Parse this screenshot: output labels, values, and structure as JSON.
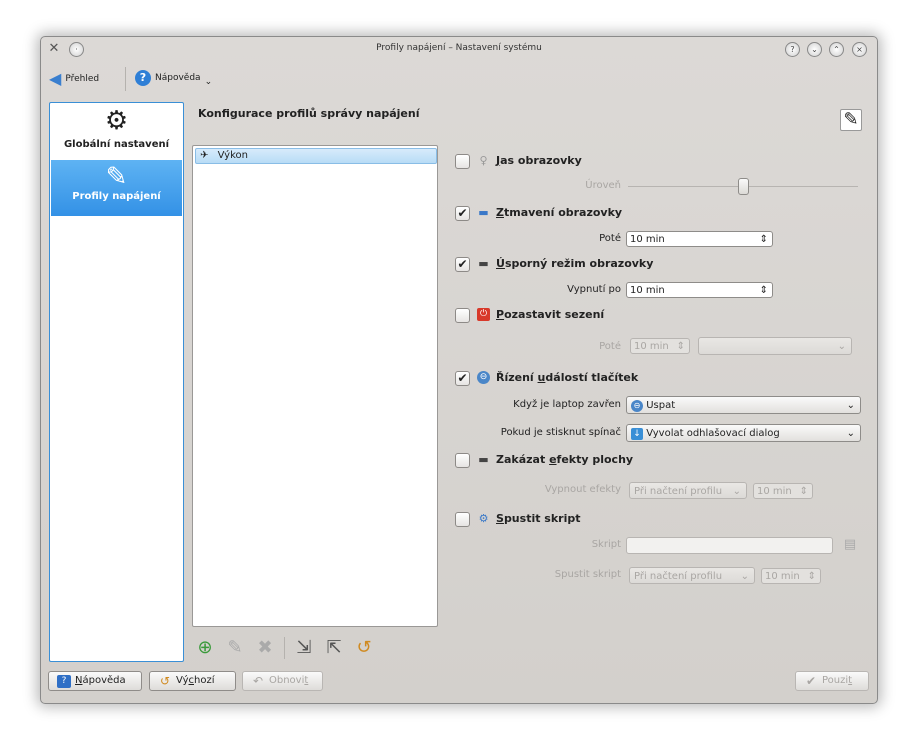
{
  "window": {
    "title": "Profily napájení – Nastavení systému"
  },
  "toolbar": {
    "overview_label": "Přehled",
    "help_label": "Nápověda"
  },
  "sidebar": {
    "items": [
      {
        "label": "Globální nastavení"
      },
      {
        "label": "Profily napájení"
      }
    ]
  },
  "main": {
    "heading": "Konfigurace profilů správy napájení",
    "profiles": [
      {
        "label": "Výkon"
      }
    ]
  },
  "settings": {
    "brightness": {
      "label_pre": "",
      "label_ul": "J",
      "label_post": "as obrazovky",
      "checked": false,
      "level_label": "Úroveň",
      "level_value": 0.5
    },
    "dim": {
      "label_pre": "",
      "label_ul": "Z",
      "label_post": "tmavení obrazovky",
      "checked": true,
      "after_label": "Poté",
      "after_value": "10 min"
    },
    "saver": {
      "label_pre": "",
      "label_ul": "Ú",
      "label_post": "sporný režim obrazovky",
      "checked": true,
      "off_label": "Vypnutí po",
      "off_value": "10 min"
    },
    "suspend": {
      "label_pre": "",
      "label_ul": "P",
      "label_post": "ozastavit sezení",
      "checked": false,
      "after_label": "Poté",
      "after_value": "10 min",
      "action_value": ""
    },
    "buttons": {
      "label_pre": "Řízení ",
      "label_ul": "u",
      "label_post": "dálostí tlačítek",
      "checked": true,
      "lid_label": "Když je laptop zavřen",
      "lid_value": "Uspat",
      "power_label": "Pokud je stisknut spínač",
      "power_value": "Vyvolat odhlašovací dialog"
    },
    "effects": {
      "label_pre": "Zakázat ",
      "label_ul": "e",
      "label_post": "fekty plochy",
      "checked": false,
      "off_label": "Vypnout efekty",
      "when_value": "Při načtení profilu",
      "time_value": "10 min"
    },
    "script": {
      "label_pre": "",
      "label_ul": "S",
      "label_post": "pustit skript",
      "checked": false,
      "script_label": "Skript",
      "script_value": "",
      "run_label": "Spustit skript",
      "when_value": "Při načtení profilu",
      "time_value": "10 min"
    }
  },
  "footer": {
    "help_pre": "",
    "help_ul": "N",
    "help_post": "ápověda",
    "default_pre": "Vý",
    "default_ul": "c",
    "default_post": "hozí",
    "reset_pre": "Obnovi",
    "reset_ul": "t",
    "reset_post": "",
    "apply_pre": "Pouzi",
    "apply_ul": "t",
    "apply_post": ""
  },
  "colors": {
    "accent": "#3391e6",
    "selection": "#b8dcf6"
  }
}
